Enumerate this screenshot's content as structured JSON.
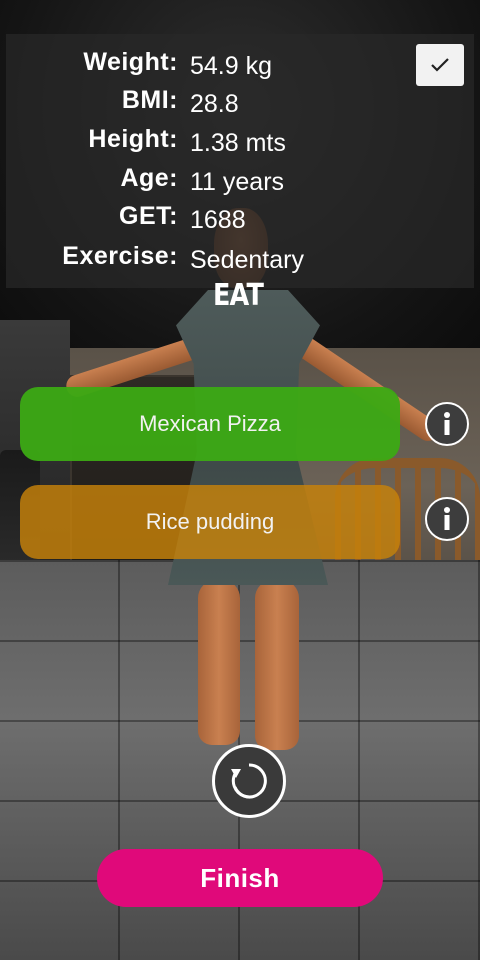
{
  "stats": [
    {
      "label": "Weight:",
      "value": "54.9 kg"
    },
    {
      "label": "BMI:",
      "value": "28.8"
    },
    {
      "label": "Height:",
      "value": "1.38 mts"
    },
    {
      "label": "Age:",
      "value": "11 years"
    },
    {
      "label": "GET:",
      "value": "1688"
    },
    {
      "label": "Exercise:",
      "value": "Sedentary"
    }
  ],
  "section_title": "EAT",
  "foods": [
    {
      "label": "Mexican Pizza",
      "color": "#3caa14"
    },
    {
      "label": "Rice pudding",
      "color": "#c8820a"
    }
  ],
  "icons": {
    "confirm": "check-icon",
    "info": "info-icon",
    "rotate": "rotate-icon"
  },
  "finish_label": "Finish",
  "colors": {
    "finish": "#e0097a",
    "panel": "#282828"
  }
}
